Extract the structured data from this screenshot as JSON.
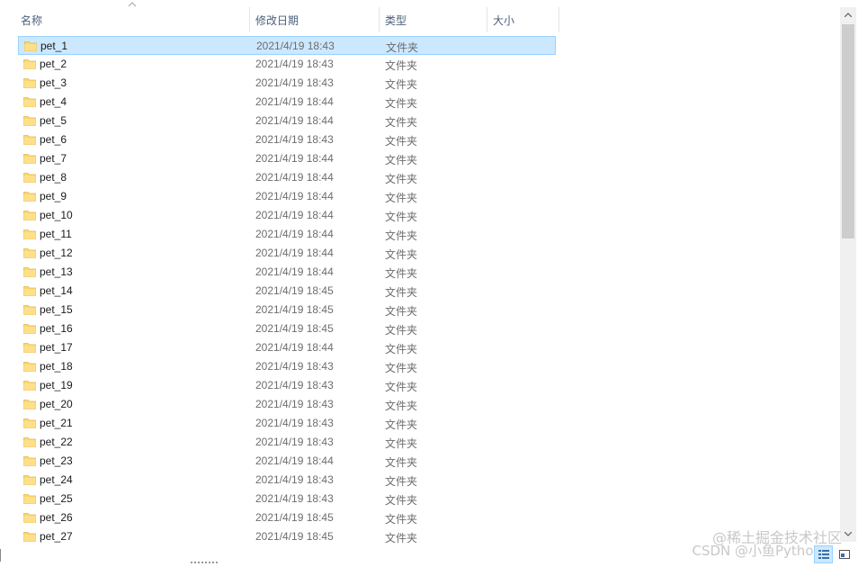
{
  "columns": {
    "name": "名称",
    "date": "修改日期",
    "type": "类型",
    "size": "大小"
  },
  "rows": [
    {
      "name": "pet_1",
      "date": "2021/4/19 18:43",
      "type": "文件夹",
      "selected": true
    },
    {
      "name": "pet_2",
      "date": "2021/4/19 18:43",
      "type": "文件夹"
    },
    {
      "name": "pet_3",
      "date": "2021/4/19 18:43",
      "type": "文件夹"
    },
    {
      "name": "pet_4",
      "date": "2021/4/19 18:44",
      "type": "文件夹"
    },
    {
      "name": "pet_5",
      "date": "2021/4/19 18:44",
      "type": "文件夹"
    },
    {
      "name": "pet_6",
      "date": "2021/4/19 18:43",
      "type": "文件夹"
    },
    {
      "name": "pet_7",
      "date": "2021/4/19 18:44",
      "type": "文件夹"
    },
    {
      "name": "pet_8",
      "date": "2021/4/19 18:44",
      "type": "文件夹"
    },
    {
      "name": "pet_9",
      "date": "2021/4/19 18:44",
      "type": "文件夹"
    },
    {
      "name": "pet_10",
      "date": "2021/4/19 18:44",
      "type": "文件夹"
    },
    {
      "name": "pet_11",
      "date": "2021/4/19 18:44",
      "type": "文件夹"
    },
    {
      "name": "pet_12",
      "date": "2021/4/19 18:44",
      "type": "文件夹"
    },
    {
      "name": "pet_13",
      "date": "2021/4/19 18:44",
      "type": "文件夹"
    },
    {
      "name": "pet_14",
      "date": "2021/4/19 18:45",
      "type": "文件夹"
    },
    {
      "name": "pet_15",
      "date": "2021/4/19 18:45",
      "type": "文件夹"
    },
    {
      "name": "pet_16",
      "date": "2021/4/19 18:45",
      "type": "文件夹"
    },
    {
      "name": "pet_17",
      "date": "2021/4/19 18:44",
      "type": "文件夹"
    },
    {
      "name": "pet_18",
      "date": "2021/4/19 18:43",
      "type": "文件夹"
    },
    {
      "name": "pet_19",
      "date": "2021/4/19 18:43",
      "type": "文件夹"
    },
    {
      "name": "pet_20",
      "date": "2021/4/19 18:43",
      "type": "文件夹"
    },
    {
      "name": "pet_21",
      "date": "2021/4/19 18:43",
      "type": "文件夹"
    },
    {
      "name": "pet_22",
      "date": "2021/4/19 18:43",
      "type": "文件夹"
    },
    {
      "name": "pet_23",
      "date": "2021/4/19 18:44",
      "type": "文件夹"
    },
    {
      "name": "pet_24",
      "date": "2021/4/19 18:43",
      "type": "文件夹"
    },
    {
      "name": "pet_25",
      "date": "2021/4/19 18:43",
      "type": "文件夹"
    },
    {
      "name": "pet_26",
      "date": "2021/4/19 18:45",
      "type": "文件夹"
    },
    {
      "name": "pet_27",
      "date": "2021/4/19 18:45",
      "type": "文件夹"
    }
  ],
  "icons": {
    "folder": "folder-icon",
    "sort": "sort-ascending-icon",
    "details_view": "details-view-icon",
    "large_icons_view": "large-icons-view-icon"
  },
  "colors": {
    "selection_bg": "#cce8ff",
    "selection_border": "#99d1ff",
    "folder_yellow": "#ffd86b",
    "header_text": "#4c607a",
    "meta_text": "#6d6d6d"
  },
  "watermark": {
    "line1": "@稀土掘金技术社区",
    "line2": "CSDN @小鱼Python"
  }
}
